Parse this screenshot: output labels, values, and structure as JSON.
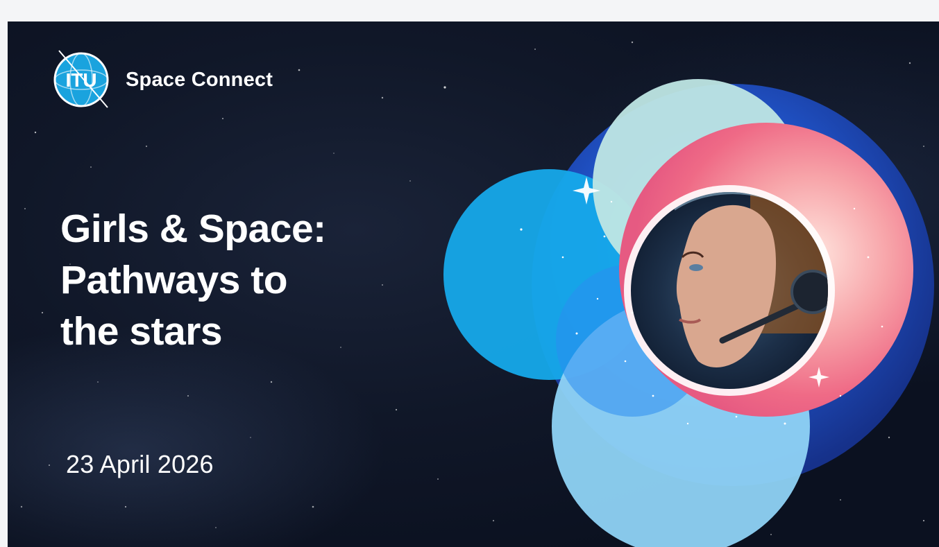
{
  "brand": {
    "logo_text": "ITU",
    "product_name": "Space Connect"
  },
  "event": {
    "title_lines": [
      "Girls & Space:",
      "Pathways to",
      "the stars"
    ],
    "date": "23 April 2026"
  },
  "colors": {
    "background": "#101728",
    "circle_cyan": "#16a9ea",
    "circle_light_blue": "#8fd3f5",
    "circle_mint": "#bfe6e4",
    "circle_deep_blue": "#1f5fd0",
    "nebula_pink": "#f27a8f",
    "text": "#ffffff"
  },
  "icons": {
    "logo": "itu-globe-logo",
    "hero_image": "astronaut-woman-portrait"
  }
}
